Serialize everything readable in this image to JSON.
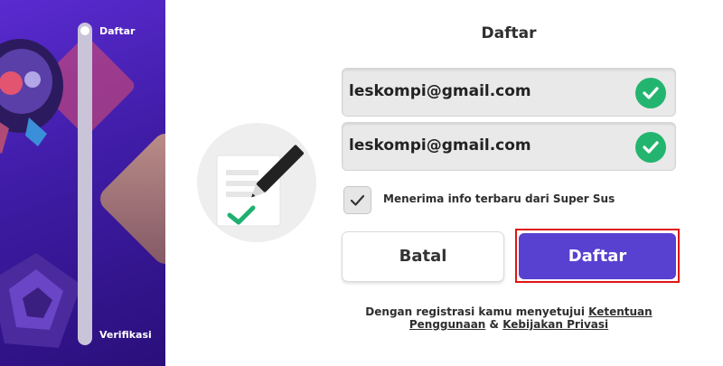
{
  "sidebar": {
    "steps": [
      {
        "label": "Daftar"
      },
      {
        "label": "Verifikasi"
      }
    ]
  },
  "form": {
    "title": "Daftar",
    "email_value": "leskompi@gmail.com",
    "email_confirm_value": "leskompi@gmail.com",
    "newsletter_label": "Menerima info terbaru dari Super Sus",
    "newsletter_checked": true
  },
  "buttons": {
    "cancel_label": "Batal",
    "submit_label": "Daftar"
  },
  "terms": {
    "prefix": "Dengan registrasi kamu menyetujui",
    "terms_link": "Ketentuan Penggunaan",
    "and": "&",
    "privacy_link": "Kebijakan Privasi"
  },
  "colors": {
    "accent": "#5840d0",
    "success": "#23b56f",
    "highlight": "#e01515",
    "sidebar": "#3f1ca6"
  }
}
